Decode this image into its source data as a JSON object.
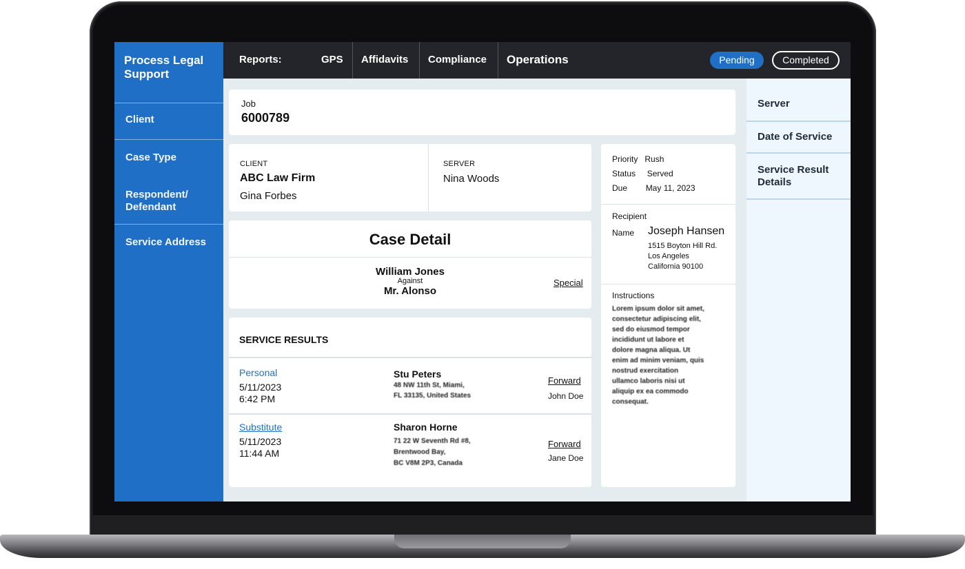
{
  "brand": {
    "line1": "Process Legal",
    "line2": "Support"
  },
  "sidebar": {
    "items": [
      "Client",
      "Case Type",
      "Respondent/",
      "Defendant",
      "Service Address"
    ]
  },
  "topbar": {
    "reports_label": "Reports:",
    "tabs": [
      "GPS",
      "Affidavits",
      "Compliance",
      "Operations"
    ],
    "status_pending": "Pending",
    "status_completed": "Completed",
    "accent": "#1f6fc6"
  },
  "right_panel": {
    "items": [
      "Server",
      "Date of Service",
      "Service Result",
      "Details"
    ]
  },
  "job": {
    "label": "Job",
    "number": "6000789"
  },
  "client": {
    "label": "CLIENT",
    "firm": "ABC Law Firm",
    "contact": "Gina Forbes"
  },
  "server": {
    "label": "SERVER",
    "name": "Nina Woods"
  },
  "info": {
    "priority_label": "Priority",
    "priority": "Rush",
    "status_label": "Status",
    "status": "Served",
    "due_label": "Due",
    "due": "May 11, 2023"
  },
  "recipient": {
    "label": "Recipient",
    "name_label": "Name",
    "name": "Joseph Hansen",
    "address": [
      "1515 Boyton Hill Rd.",
      "Los Angeles",
      "California 90100"
    ]
  },
  "instructions": {
    "label": "Instructions",
    "lines": [
      "Lorem ipsum dolor sit amet,",
      "consectetur adipiscing elit,",
      "sed do eiusmod tempor",
      "incididunt ut labore et",
      "dolore magna aliqua. Ut",
      "enim ad minim veniam, quis",
      "nostrud exercitation",
      "ullamco laboris nisi ut",
      "aliquip ex ea commodo",
      "consequat."
    ]
  },
  "case_detail": {
    "title": "Case Detail",
    "plaintiff": "William Jones",
    "versus": "Against",
    "defendant": "Mr. Alonso",
    "type_link": "Special"
  },
  "service_results": {
    "title": "SERVICE RESULTS",
    "rows": [
      {
        "type": "Personal",
        "date": "5/11/2023",
        "time": "6:42 PM",
        "person": "Stu Peters",
        "address": [
          "48 NW 11th St, Miami,",
          "FL 33135, United States"
        ],
        "action": "Forward",
        "by": "John Doe"
      },
      {
        "type": "Substitute",
        "date": "5/11/2023",
        "time": "11:44 AM",
        "person": "Sharon Horne",
        "address": [
          "71 22 W Seventh Rd #8,",
          "Brentwood Bay,",
          "BC V8M 2P3, Canada"
        ],
        "action": "Forward",
        "by": "Jane Doe"
      }
    ]
  }
}
